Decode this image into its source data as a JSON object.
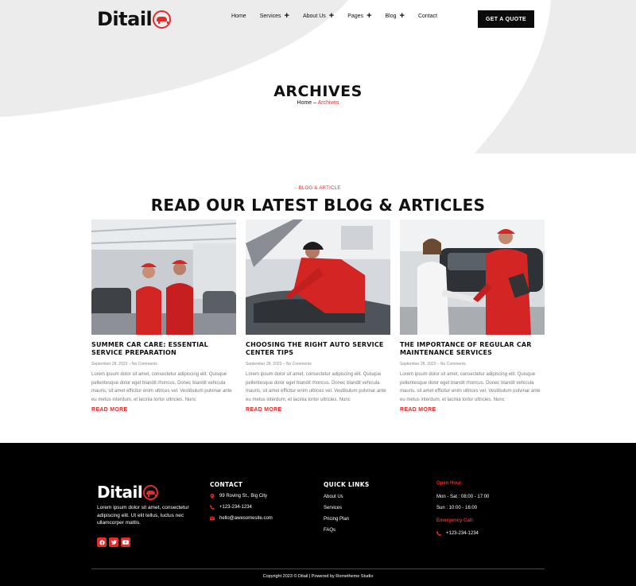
{
  "brand": {
    "name": "Ditail",
    "accent_color": "#e42b2b"
  },
  "nav": {
    "items": [
      {
        "label": "Home",
        "has_submenu": false
      },
      {
        "label": "Services",
        "has_submenu": true
      },
      {
        "label": "About Us",
        "has_submenu": true
      },
      {
        "label": "Pages",
        "has_submenu": true
      },
      {
        "label": "Blog",
        "has_submenu": true
      },
      {
        "label": "Contact",
        "has_submenu": false
      }
    ],
    "plus": "+",
    "cta": "GET A QUOTE"
  },
  "hero": {
    "title": "ARCHIVES",
    "breadcrumb": {
      "home": "Home",
      "sep": " – ",
      "current": "Archives"
    }
  },
  "blog": {
    "eyebrow": "- BLOG & ARTICLE",
    "title": "READ OUR LATEST BLOG & ARTICLES",
    "posts": [
      {
        "title": "SUMMER CAR CARE: ESSENTIAL SERVICE PREPARATION",
        "meta": "September 28, 2023 – No Comments",
        "excerpt": "Lorem ipsum dolor sit amet, consectetur adipiscing elit. Quisque pellentesque dolor eget blandit rhoncus. Donec blandit vehicula mauris, sit amet efficitur enim ultrices vel. Vestibulum pulvinar ante eu metus interdum, et lacinia tortor ultricies. Nunc",
        "read_more": "READ MORE",
        "image": "two-mechanics-in-garage-photo"
      },
      {
        "title": "CHOOSING THE RIGHT AUTO SERVICE CENTER TIPS",
        "meta": "September 28, 2023 – No Comments",
        "excerpt": "Lorem ipsum dolor sit amet, consectetur adipiscing elit. Quisque pellentesque dolor eget blandit rhoncus. Donec blandit vehicula mauris, sit amet efficitur enim ultrices vel. Vestibulum pulvinar ante eu metus interdum, et lacinia tortor ultricies. Nunc",
        "read_more": "READ MORE",
        "image": "mechanic-inspecting-engine-photo"
      },
      {
        "title": "THE IMPORTANCE OF REGULAR CAR MAINTENANCE SERVICES",
        "meta": "September 28, 2023 – No Comments",
        "excerpt": "Lorem ipsum dolor sit amet, consectetur adipiscing elit. Quisque pellentesque dolor eget blandit rhoncus. Donec blandit vehicula mauris, sit amet efficitur enim ultrices vel. Vestibulum pulvinar ante eu metus interdum, et lacinia tortor ultricies. Nunc",
        "read_more": "READ MORE",
        "image": "mechanic-handshake-customer-photo"
      }
    ]
  },
  "footer": {
    "about": "Lorem ipsum dolor sit amet, consectetur adipiscing elit. Ut elit tellus, luctus nec ullamcorper mattis.",
    "socials": [
      "facebook-icon",
      "twitter-icon",
      "youtube-icon"
    ],
    "contact": {
      "title": "CONTACT",
      "address": "99 Roving St., Big City",
      "phone": "+123-234-1234",
      "email": "hello@awesomesite.com"
    },
    "quick_links": {
      "title": "QUICK LINKS",
      "items": [
        "About Us",
        "Services",
        "Pricing Plan",
        "FAQs"
      ]
    },
    "hours": {
      "open_label": "Open Hour:",
      "weekdays": "Mon - Sat : 08:00 - 17:00",
      "sunday": "Sun : 10:00 - 16:00",
      "emergency_label": "Emergency Call:",
      "emergency_phone": "+123-234-1234"
    },
    "copyright": "Copyright 2023 © Ditail | Powered by Rometheme Studio"
  }
}
